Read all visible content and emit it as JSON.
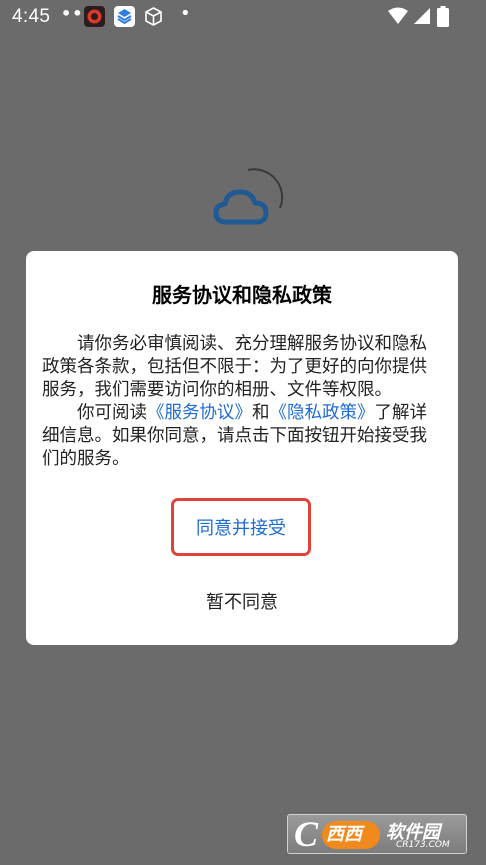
{
  "status_bar": {
    "time": "4:45",
    "dots": "•••",
    "notification_dot": "•",
    "icons": [
      "app-red-icon",
      "layers-icon",
      "cube-icon",
      "wifi-icon",
      "cell-signal-icon",
      "battery-icon"
    ]
  },
  "loader": {
    "logo": "cloud-icon",
    "logo_color": "#1f5a92"
  },
  "dialog": {
    "title": "服务协议和隐私政策",
    "paragraph1": "请你务必审慎阅读、充分理解服务协议和隐私政策各条款，包括但不限于：为了更好的向你提供服务，我们需要访问你的相册、文件等权限。",
    "paragraph2_pre": "你可阅读",
    "terms_link": "《服务协议》",
    "and_text": "和",
    "privacy_link": "《隐私政策》",
    "paragraph2_post": "了解详细信息。如果你同意，请点击下面按钮开始接受我们的服务。",
    "accept_label": "同意并接受",
    "decline_label": "暂不同意"
  },
  "colors": {
    "overlay": "#6b6b6b",
    "link": "#1e6bd6",
    "highlight_border": "#e0433a"
  },
  "watermark": {
    "letter": "C",
    "badge": "西西",
    "name": "软件园",
    "url": "CR173.COM"
  }
}
